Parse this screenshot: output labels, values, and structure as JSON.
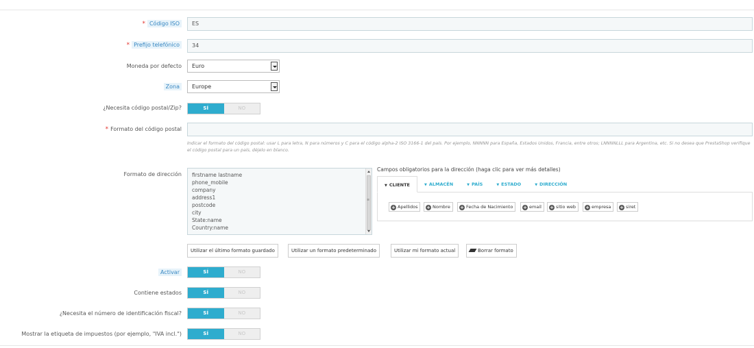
{
  "fields": {
    "iso_code": {
      "label": "Código ISO",
      "value": "ES"
    },
    "phone_prefix": {
      "label": "Prefijo telefónico",
      "value": "34"
    },
    "default_currency": {
      "label": "Moneda por defecto",
      "value": "Euro"
    },
    "zone": {
      "label": "Zona",
      "value": "Europe"
    },
    "needs_zip": {
      "label": "¿Necesita código postal/Zip?",
      "on": "SÍ",
      "off": "NO"
    },
    "zip_format": {
      "label": "Formato del código postal",
      "value": "",
      "help": "Indicar el formato del código postal: usar L para letra, N para números y C para el código alpha-2 ISO 3166-1 del país. Por ejemplo, NNNNN para España, Estados Unidos, Francia, entre otros; LNNNNLLL para Argentina, etc. Si no desea que PrestaShop verifique el código postal para un país, déjelo en blanco."
    },
    "address_format": {
      "label": "Formato de dirección",
      "lines": [
        "firstname lastname",
        "phone_mobile",
        "company",
        "address1",
        "postcode",
        "city",
        "State:name",
        "Country:name"
      ]
    },
    "active": {
      "label": "Activar",
      "on": "SÍ",
      "off": "NO"
    },
    "contains_states": {
      "label": "Contiene estados",
      "on": "SÍ",
      "off": "NO"
    },
    "needs_tax_id": {
      "label": "¿Necesita el número de identificación fiscal?",
      "on": "SÍ",
      "off": "NO"
    },
    "display_tax_label": {
      "label": "Mostrar la etiqueta de impuestos (por ejemplo, \"IVA incl.\")",
      "on": "SÍ",
      "off": "NO"
    }
  },
  "required_fields": {
    "title": "Campos obligatorios para la dirección (haga clic para ver más detalles)",
    "tabs": [
      "CLIENTE",
      "ALMACÉN",
      "PAÍS",
      "ESTADO",
      "DIRECCIÓN"
    ],
    "buttons": [
      "Apellidos",
      "Nombre",
      "Fecha de Nacimiento",
      "email",
      "sitio web",
      "empresa",
      "siret"
    ]
  },
  "format_actions": {
    "last_saved": "Utilizar el último formato guardado",
    "default": "Utilizar un formato predeterminado",
    "current": "Utilizar mi formato actual",
    "clear": "Borrar formato"
  },
  "colors": {
    "accent": "#2eacce",
    "required": "#e3342f",
    "label_highlight": "#3887c2"
  }
}
